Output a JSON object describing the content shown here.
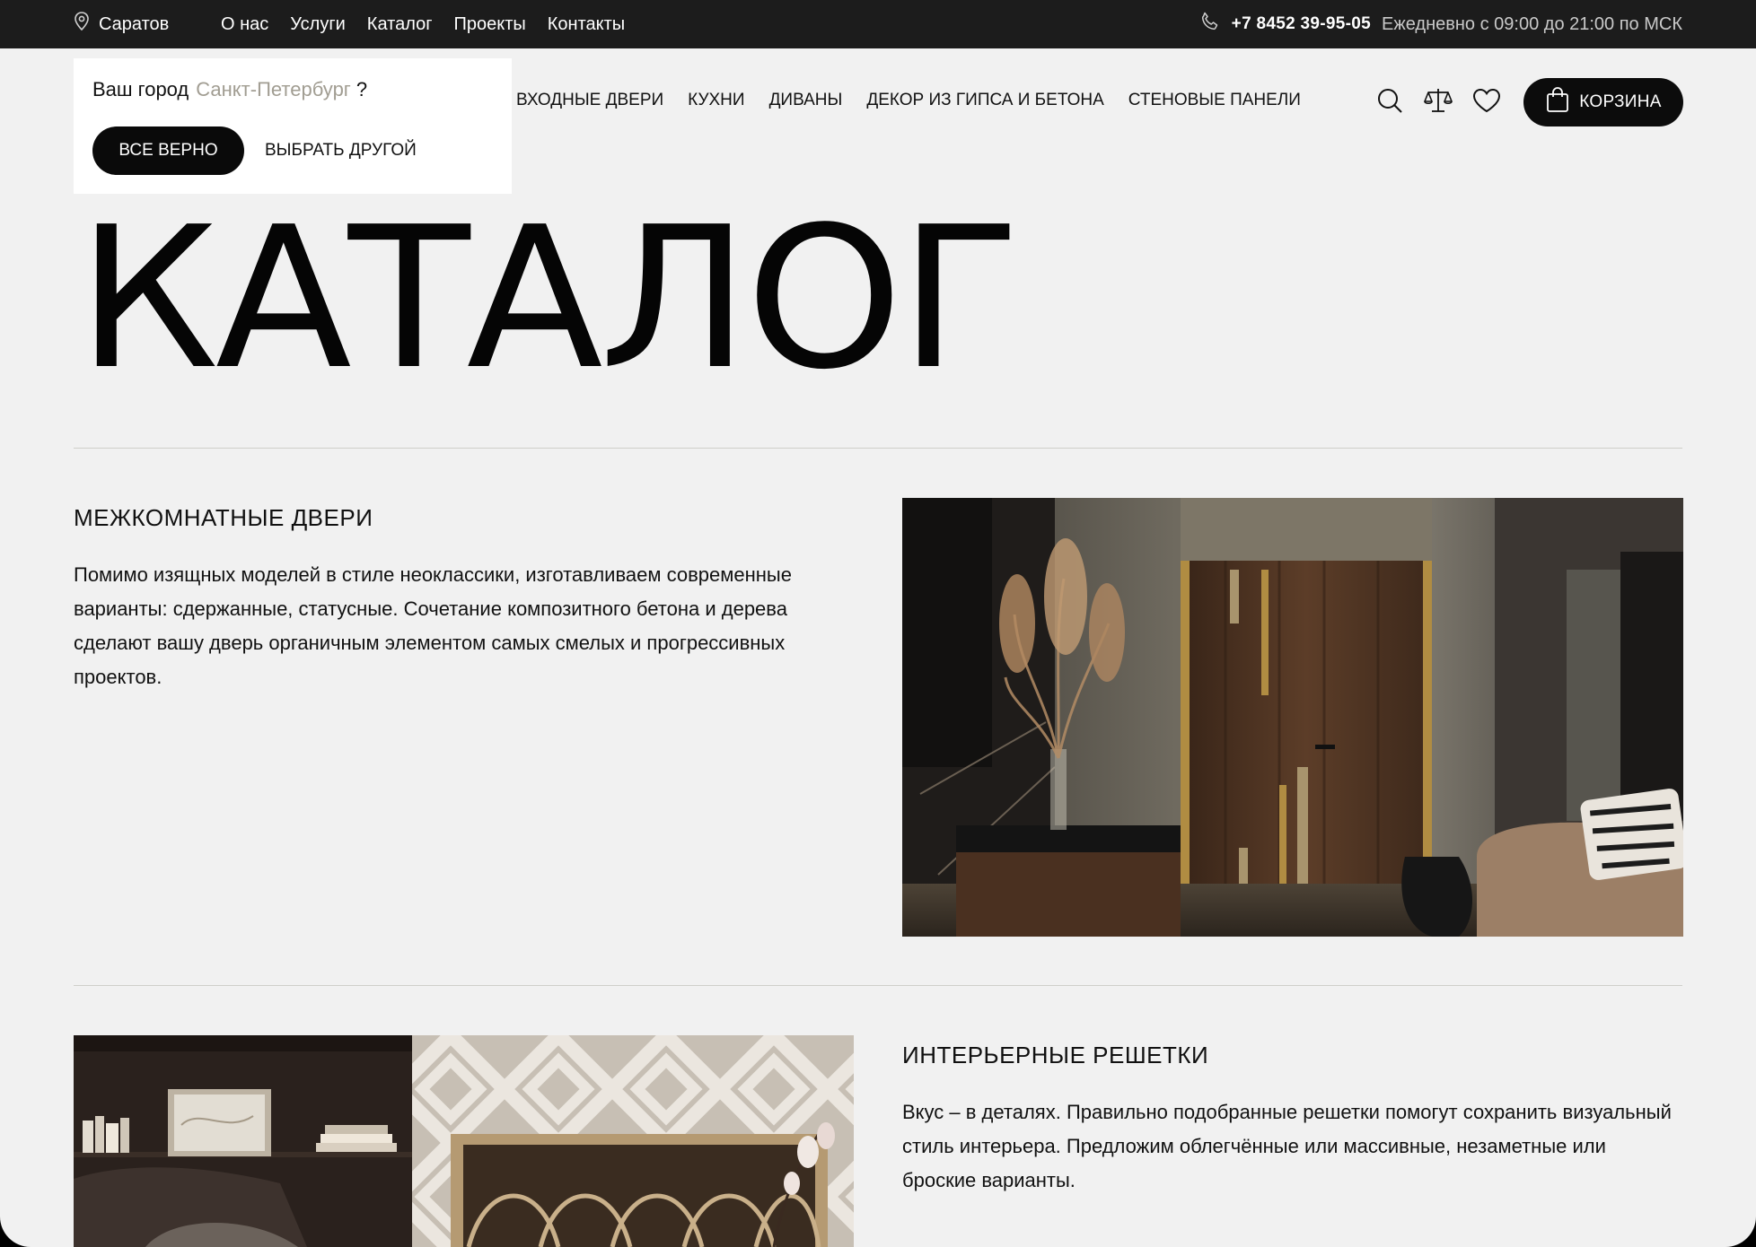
{
  "topbar": {
    "city": "Саратов",
    "nav": [
      "О нас",
      "Услуги",
      "Каталог",
      "Проекты",
      "Контакты"
    ],
    "phone": "+7 8452 39-95-05",
    "hours": "Ежедневно с 09:00 до 21:00 по МСК"
  },
  "city_popup": {
    "question": "Ваш город",
    "city": "Санкт-Петербург",
    "mark": "?",
    "confirm_label": "ВСЕ ВЕРНО",
    "change_label": "ВЫБРАТЬ ДРУГОЙ"
  },
  "main_nav": [
    "ВХОДНЫЕ ДВЕРИ",
    "КУХНИ",
    "ДИВАНЫ",
    "ДЕКОР ИЗ ГИПСА И БЕТОНА",
    "СТЕНОВЫЕ ПАНЕЛИ"
  ],
  "header_icons": [
    "search-icon",
    "compare-icon",
    "heart-icon"
  ],
  "cart": {
    "label": "КОРЗИНА",
    "icon": "bag-icon"
  },
  "page_title": "КАТАЛОГ",
  "sections": [
    {
      "title": "МЕЖКОМНАТНЫЕ ДВЕРИ",
      "text": "Помимо изящных моделей в стиле неоклассики, изготавливаем современные варианты: сдержанные, статусные. Сочетание композитного бетона и дерева сделают вашу дверь органичным элементом самых смелых и прогрессивных проектов."
    },
    {
      "title": "ИНТЕРЬЕРНЫЕ РЕШЕТКИ",
      "text": "Вкус – в деталях. Правильно подобранные решетки помогут сохранить визуальный стиль интерьера. Предложим облегчённые или массивные, незаметные или броские варианты."
    }
  ],
  "colors": {
    "topbar": "#1c1c1c",
    "background": "#f1f1f1",
    "accent_city": "#a19d92",
    "button": "#0a0a0a"
  }
}
